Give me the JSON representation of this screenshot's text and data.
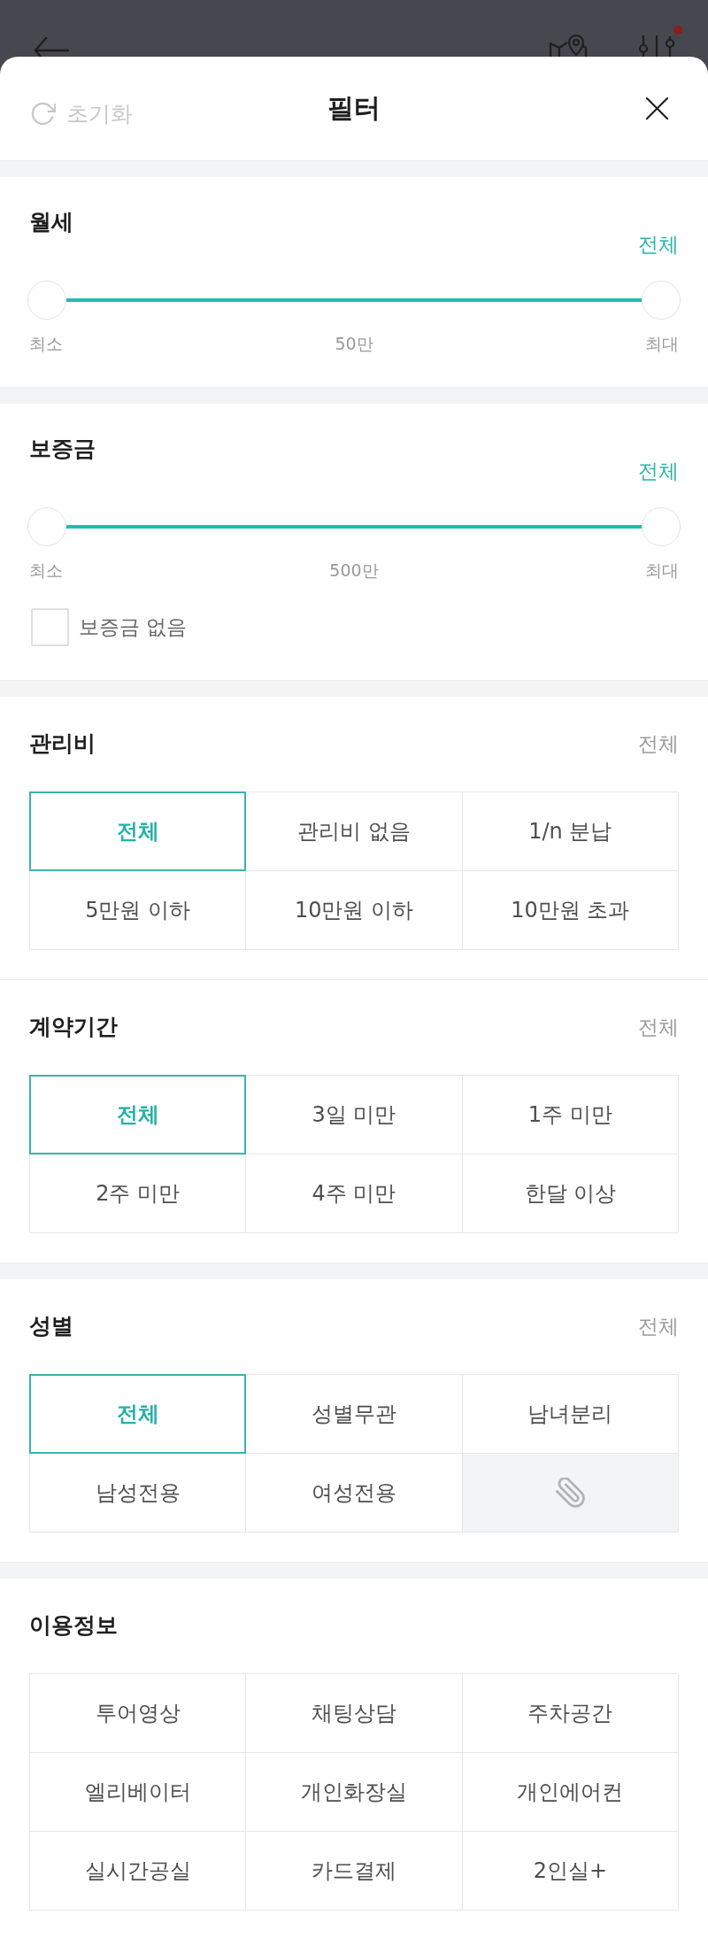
{
  "top_bar": {
    "notification": true
  },
  "header": {
    "reset": "초기화",
    "title": "필터"
  },
  "cards": [
    {
      "sections": [
        {
          "kind": "range",
          "title": "월세",
          "value": "전체",
          "level": 1,
          "min_label": "최소",
          "mid_label": "50만",
          "max_label": "최대"
        }
      ]
    },
    {
      "sections": [
        {
          "kind": "range",
          "title": "보증금",
          "value": "전체",
          "level": 1,
          "min_label": "최소",
          "mid_label": "500만",
          "max_label": "최대",
          "checkbox": {
            "label": "보증금 없음",
            "checked": false
          }
        }
      ]
    },
    {
      "sections": [
        {
          "kind": "options",
          "title": "관리비",
          "value": "전체",
          "options": [
            {
              "kind": "text",
              "label": "전체",
              "selected": true
            },
            {
              "kind": "text",
              "label": "관리비 없음",
              "selected": false
            },
            {
              "kind": "text",
              "label": "1/n 분납",
              "selected": false
            },
            {
              "kind": "text",
              "label": "5만원 이하",
              "selected": false
            },
            {
              "kind": "text",
              "label": "10만원 이하",
              "selected": false
            },
            {
              "kind": "text",
              "label": "10만원 초과",
              "selected": false
            }
          ]
        },
        {
          "kind": "options",
          "title": "계약기간",
          "value": "전체",
          "options": [
            {
              "kind": "text",
              "label": "전체",
              "selected": true
            },
            {
              "kind": "text",
              "label": "3일 미만",
              "selected": false
            },
            {
              "kind": "text",
              "label": "1주 미만",
              "selected": false
            },
            {
              "kind": "text",
              "label": "2주 미만",
              "selected": false
            },
            {
              "kind": "text",
              "label": "4주 미만",
              "selected": false
            },
            {
              "kind": "text",
              "label": "한달 이상",
              "selected": false
            }
          ]
        }
      ]
    },
    {
      "sections": [
        {
          "kind": "options",
          "title": "성별",
          "value": "전체",
          "options": [
            {
              "kind": "text",
              "label": "전체",
              "selected": true
            },
            {
              "kind": "text",
              "label": "성별무관",
              "selected": false
            },
            {
              "kind": "text",
              "label": "남녀분리",
              "selected": false
            },
            {
              "kind": "text",
              "label": "남성전용",
              "selected": false
            },
            {
              "kind": "text",
              "label": "여성전용",
              "selected": false
            },
            {
              "kind": "icon",
              "selected": false
            }
          ]
        }
      ]
    },
    {
      "sections": [
        {
          "kind": "options",
          "title": "이용정보",
          "options": [
            {
              "kind": "text",
              "label": "투어영상",
              "selected": false
            },
            {
              "kind": "text",
              "label": "채팅상담",
              "selected": false
            },
            {
              "kind": "text",
              "label": "주차공간",
              "selected": false
            },
            {
              "kind": "text",
              "label": "엘리베이터",
              "selected": false
            },
            {
              "kind": "text",
              "label": "개인화장실",
              "selected": false
            },
            {
              "kind": "text",
              "label": "개인에어컨",
              "selected": false
            },
            {
              "kind": "text",
              "label": "실시간공실",
              "selected": false
            },
            {
              "kind": "text",
              "label": "카드결제",
              "selected": false
            },
            {
              "kind": "text",
              "label": "2인실+",
              "selected": false
            }
          ]
        }
      ]
    }
  ]
}
